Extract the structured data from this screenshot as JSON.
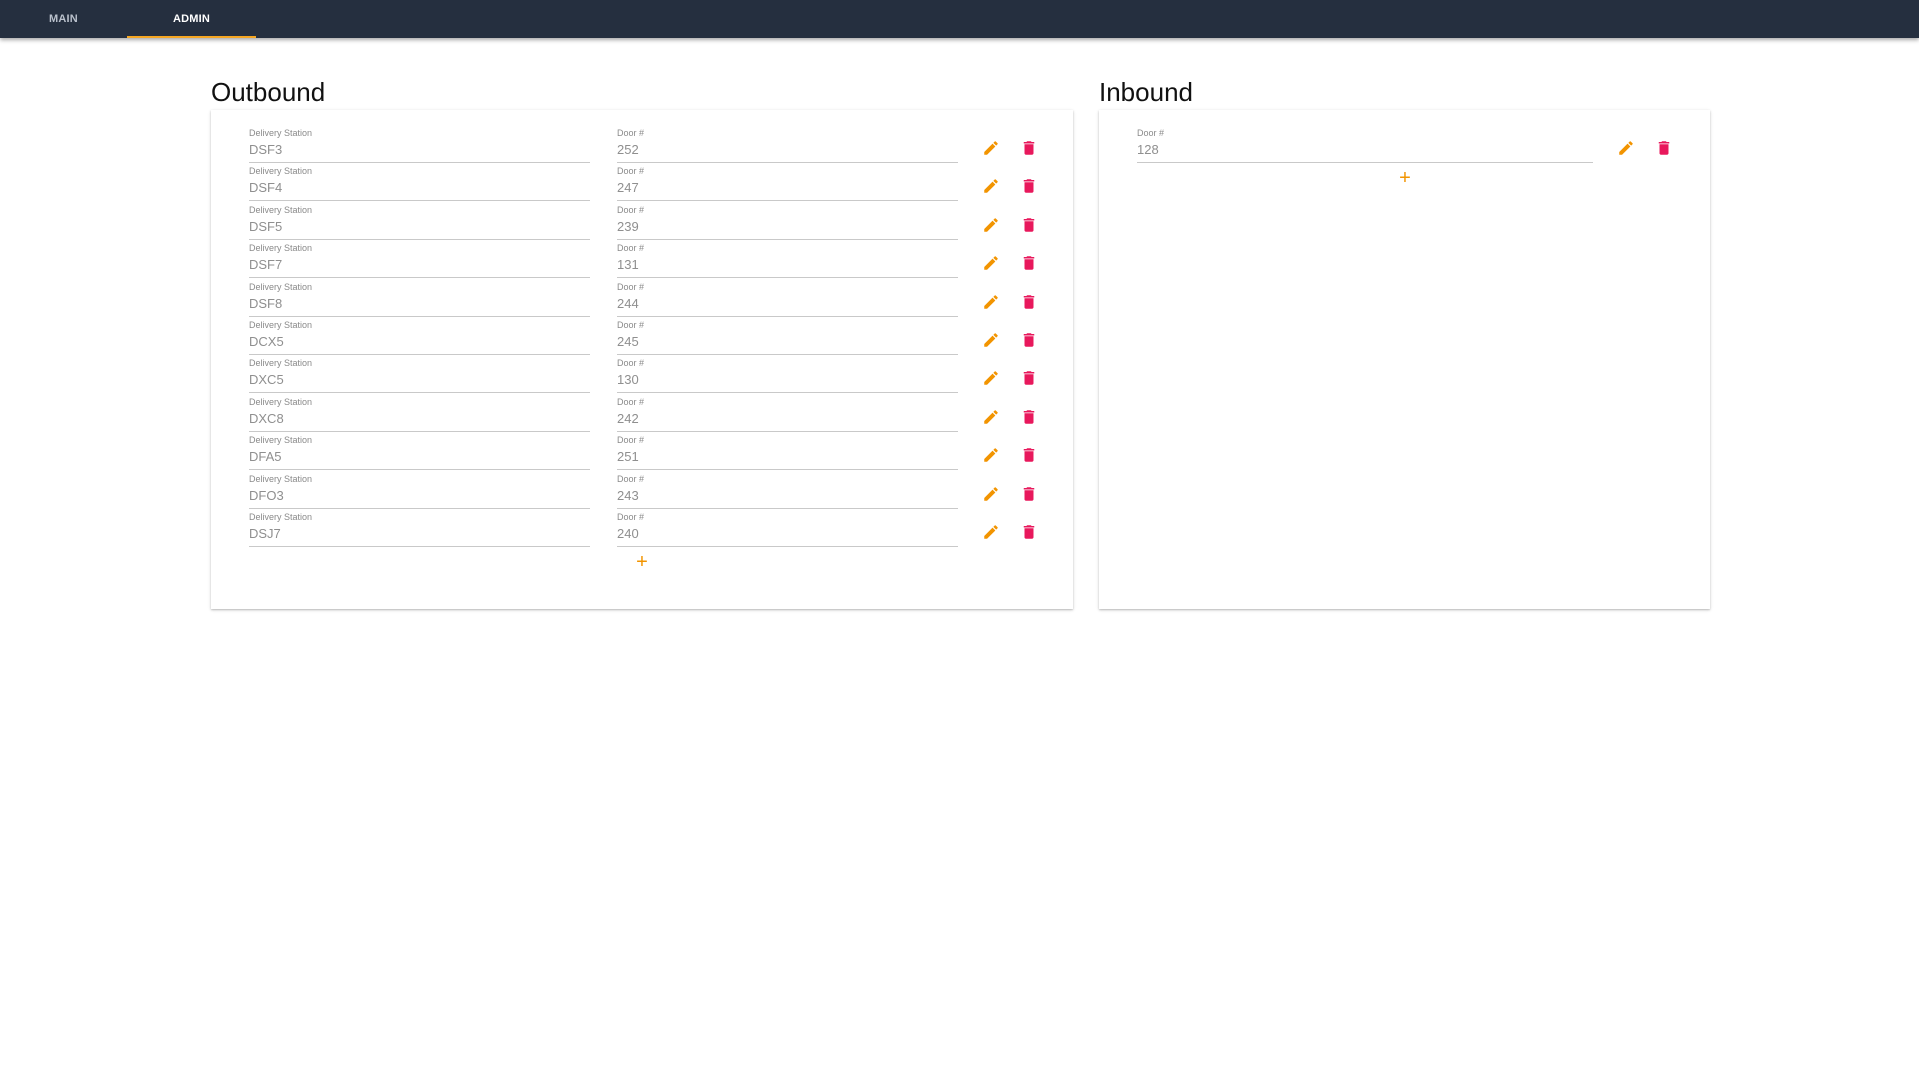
{
  "nav": {
    "tabs": [
      {
        "label": "MAIN"
      },
      {
        "label": "ADMIN"
      }
    ]
  },
  "outbound": {
    "title": "Outbound",
    "station_label": "Delivery Station",
    "door_label": "Door #",
    "rows": [
      {
        "station": "DSF3",
        "door": "252"
      },
      {
        "station": "DSF4",
        "door": "247"
      },
      {
        "station": "DSF5",
        "door": "239"
      },
      {
        "station": "DSF7",
        "door": "131"
      },
      {
        "station": "DSF8",
        "door": "244"
      },
      {
        "station": "DCX5",
        "door": "245"
      },
      {
        "station": "DXC5",
        "door": "130"
      },
      {
        "station": "DXC8",
        "door": "242"
      },
      {
        "station": "DFA5",
        "door": "251"
      },
      {
        "station": "DFO3",
        "door": "243"
      },
      {
        "station": "DSJ7",
        "door": "240"
      }
    ],
    "add_label": "+"
  },
  "inbound": {
    "title": "Inbound",
    "door_label": "Door #",
    "rows": [
      {
        "door": "128"
      }
    ],
    "add_label": "+"
  },
  "colors": {
    "topbar": "#252f3f",
    "accent": "#f5a623",
    "edit_icon": "#f29400",
    "delete_icon": "#e8185c"
  },
  "icons": {
    "edit": "pencil-icon",
    "delete": "trash-icon",
    "add": "plus-icon"
  }
}
